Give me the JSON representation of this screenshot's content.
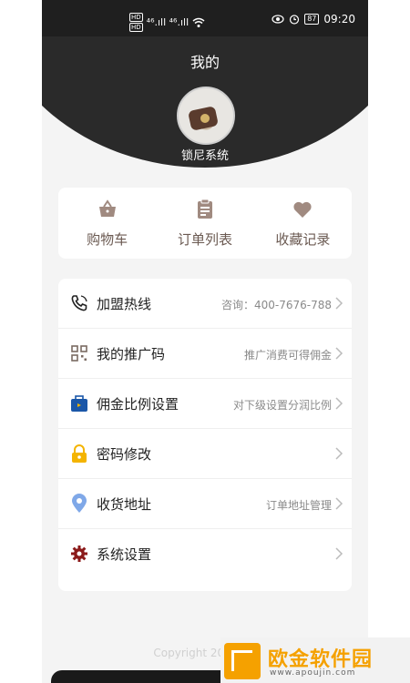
{
  "statusbar": {
    "sim1": "HD",
    "sim2": "HD",
    "signal": "⁴⁶.ıll ⁴⁶.ıll",
    "battery": "87",
    "time": "09:20"
  },
  "header": {
    "title": "我的",
    "username": "锁尼系统"
  },
  "quick_actions": [
    {
      "label": "购物车",
      "icon": "basket-icon"
    },
    {
      "label": "订单列表",
      "icon": "clipboard-icon"
    },
    {
      "label": "收藏记录",
      "icon": "heart-icon"
    }
  ],
  "menu": [
    {
      "label": "加盟热线",
      "hint": "咨询：400-7676-788",
      "icon": "phone-icon",
      "color": "#222222"
    },
    {
      "label": "我的推广码",
      "hint": "推广消费可得佣金",
      "icon": "qrcode-icon",
      "color": "#7a6a62"
    },
    {
      "label": "佣金比例设置",
      "hint": "对下级设置分润比例",
      "icon": "briefcase-icon",
      "color": "#1b57a8"
    },
    {
      "label": "密码修改",
      "hint": "",
      "icon": "lock-icon",
      "color": "#f4b400"
    },
    {
      "label": "收货地址",
      "hint": "订单地址管理",
      "icon": "location-icon",
      "color": "#7fa8e8"
    },
    {
      "label": "系统设置",
      "hint": "",
      "icon": "gear-icon",
      "color": "#8b1a1a"
    }
  ],
  "footer": {
    "copyright": "Copyright 2021 SU"
  },
  "watermark": {
    "brand": "欧金软件园",
    "url": "www.apoujin.com"
  },
  "colors": {
    "accent": "#a08a80",
    "header_bg": "#2a2a2a"
  }
}
